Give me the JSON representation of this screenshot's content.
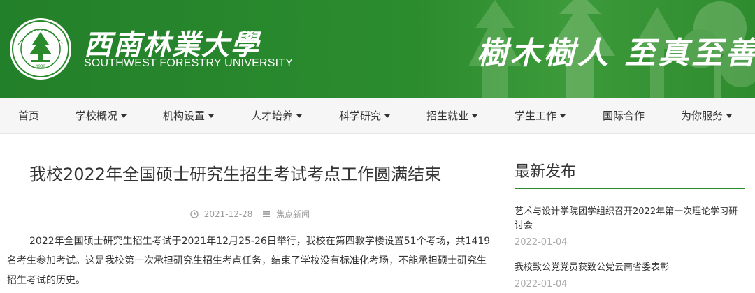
{
  "header": {
    "brand_cn": "西南林業大學",
    "brand_en": "SOUTHWEST FORESTRY UNIVERSITY",
    "motto": "樹木樹人 至真至善",
    "seal_year": "1938",
    "colors": {
      "brand_green": "#2a8a2c"
    }
  },
  "nav": {
    "items": [
      {
        "label": "首页",
        "dropdown": false
      },
      {
        "label": "学校概况",
        "dropdown": true
      },
      {
        "label": "机构设置",
        "dropdown": true
      },
      {
        "label": "人才培养",
        "dropdown": true
      },
      {
        "label": "科学研究",
        "dropdown": true
      },
      {
        "label": "招生就业",
        "dropdown": true
      },
      {
        "label": "学生工作",
        "dropdown": true
      },
      {
        "label": "国际合作",
        "dropdown": false
      },
      {
        "label": "为你服务",
        "dropdown": true
      }
    ]
  },
  "article": {
    "title": "我校2022年全国硕士研究生招生考试考点工作圆满结束",
    "date": "2021-12-28",
    "category": "焦点新闻",
    "body": "2022年全国硕士研究生招生考试于2021年12月25-26日举行，我校在第四教学楼设置51个考场，共1419名考生参加考试。这是我校第一次承担研究生招生考点任务，结束了学校没有标准化考场，不能承担硕士研究生招生考试的历史。"
  },
  "sidebar": {
    "title": "最新发布",
    "news": [
      {
        "title": "艺术与设计学院团学组织召开2022年第一次理论学习研讨会",
        "date": "2022-01-04"
      },
      {
        "title": "我校致公党党员获致公党云南省委表彰",
        "date": "2022-01-04"
      }
    ]
  }
}
